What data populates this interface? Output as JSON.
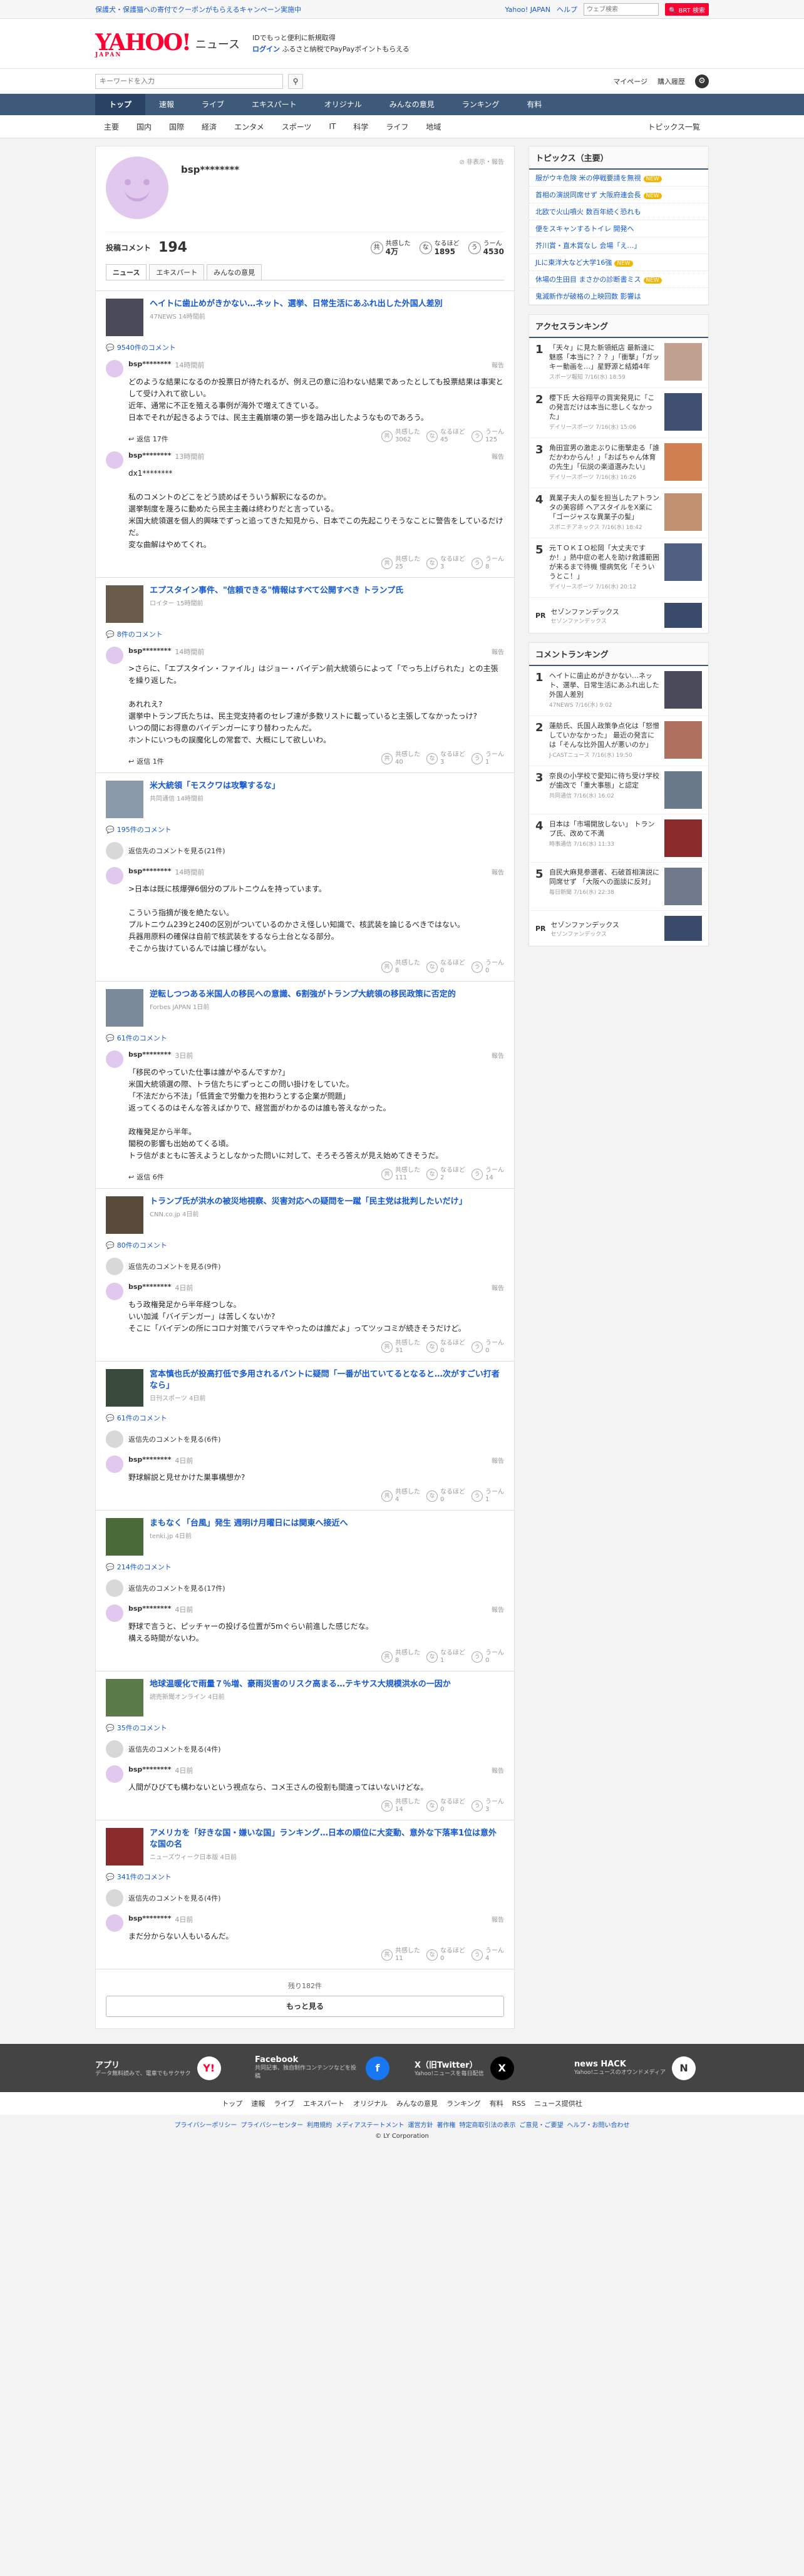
{
  "topbar": {
    "promo": "保護犬・保護猫への寄付でクーポンがもらえるキャンペーン実施中",
    "yahoo": "Yahoo! JAPAN",
    "help": "ヘルプ",
    "search_placeholder": "ウェブ検索",
    "search_btn": "🔍 BRT 検索"
  },
  "header": {
    "logo": "YAHOO!",
    "logo_sub": "JAPAN",
    "service": "ニュース",
    "line1": "IDでもっと便利に新規取得",
    "login": "ログイン",
    "line2": "ふるさと納税でPayPayポイントもらえる"
  },
  "searchrow": {
    "placeholder": "キーワードを入力",
    "mypage": "マイページ",
    "history": "購入履歴"
  },
  "nav": [
    "トップ",
    "速報",
    "ライブ",
    "エキスパート",
    "オリジナル",
    "みんなの意見",
    "ランキング",
    "有料"
  ],
  "subnav": [
    "主要",
    "国内",
    "国際",
    "経済",
    "エンタメ",
    "スポーツ",
    "IT",
    "科学",
    "ライフ",
    "地域"
  ],
  "subnav_right": "トピックス一覧",
  "profile": {
    "name": "bsp********",
    "report": "非表示・報告",
    "label": "投稿コメント",
    "count": "194",
    "reacts": [
      {
        "icon": "共",
        "label": "共感した",
        "value": "4万"
      },
      {
        "icon": "な",
        "label": "なるほど",
        "value": "1895"
      },
      {
        "icon": "う",
        "label": "うーん",
        "value": "4530"
      }
    ],
    "tabs": [
      "ニュース",
      "エキスパート",
      "みんなの意見"
    ]
  },
  "articles": [
    {
      "title": "ヘイトに歯止めがきかない…ネット、選挙、日常生活にあふれ出した外国人差別",
      "src": "47NEWS 14時間前",
      "cmt": "9540件のコメント",
      "thumb": "#4a4a5a",
      "viewall": null,
      "comments": [
        {
          "user": "bsp********",
          "time": "14時間前",
          "text": "どのような結果になるのか投票日が待たれるが、例え己の意に沿わない結果であったとしても投票結果は事実として受け入れて欲しい。\n近年、通常に不正を殖える事例が海外で増えてきている。\n日本でそれが起きるようでは、民主主義崩壊の第一歩を踏み出したようなものであろう。",
          "reply": "返信 17件",
          "votes": [
            "3062",
            "45",
            "125"
          ]
        },
        {
          "user": "bsp********",
          "time": "13時間前",
          "text": "dx1********\n\n私のコメントのどこをどう読めばそういう解釈になるのか。\n選挙制度を蔑ろに動めたら民主主義は終わりだと言っている。\n米国大統領選を個人的興味でずっと追ってきた知見から、日本でこの先起こりそうなことに警告をしているだけだ。\n変な曲解はやめてくれ。",
          "reply": "",
          "votes": [
            "25",
            "3",
            "8"
          ]
        }
      ]
    },
    {
      "title": "エプスタイン事件、\"信頼できる\"情報はすべて公開すべき トランプ氏",
      "src": "ロイター 15時間前",
      "cmt": "8件のコメント",
      "thumb": "#6a5a4a",
      "viewall": null,
      "comments": [
        {
          "user": "bsp********",
          "time": "14時間前",
          "text": ">さらに、「エプスタイン・ファイル」はジョー・バイデン前大統領らによって「でっち上げられた」との主張を繰り返した。\n\nあれれえ?\n選挙中トランプ氏たちは、民主党支持者のセレブ達が多数リストに載っていると主張してなかったっけ?\nいつの間にお得意のバイデンガーにすり替わったんだ。\nホントにいつもの誤魔化しの常套で、大概にして欲しいわ。",
          "reply": "返信 1件",
          "votes": [
            "40",
            "3",
            "1"
          ]
        }
      ]
    },
    {
      "title": "米大統領「モスクワは攻撃するな」",
      "src": "共同通信 14時間前",
      "cmt": "195件のコメント",
      "thumb": "#8a9aaa",
      "viewall": "返信先のコメントを見る(21件)",
      "comments": [
        {
          "user": "bsp********",
          "time": "14時間前",
          "text": ">日本は既に核爆弾6個分のプルトニウムを持っています。\n\nこういう指摘が後を絶たない。\nプルトニウム239と240の区別がついているのかさえ怪しい知識で、核武装を論じるべきではない。\n兵器用原料の確保は自前で核武装をするなら土台となる部分。\nそこから抜けているんでは論じ様がない。",
          "reply": "",
          "votes": [
            "8",
            "0",
            "0"
          ]
        }
      ]
    },
    {
      "title": "逆転しつつある米国人の移民への意識、6割強がトランプ大統領の移民政策に否定的",
      "src": "Forbes JAPAN 1日前",
      "cmt": "61件のコメント",
      "thumb": "#7a8a9a",
      "viewall": null,
      "comments": [
        {
          "user": "bsp********",
          "time": "3日前",
          "text": "「移民のやっていた仕事は誰がやるんですか?」\n米国大統領選の際、トラ信たちにずっとこの問い掛けをしていた。\n「不法だから不法」「低賃金で労働力を抱わうとする企業が問題」\n返ってくるのはそんな答えばかりで、経営面がわかるのは誰も答えなかった。\n\n政権発足から半年。\n閣税の影響も出始めてくる頃。\nトラ信がまともに答えようとしなかった問いに対して、そろそろ答えが見え始めてきそうだ。",
          "reply": "返信 6件",
          "votes": [
            "111",
            "2",
            "14"
          ]
        }
      ]
    },
    {
      "title": "トランプ氏が洪水の被災地視察、災害対応への疑問を一蹴「民主党は批判したいだけ」",
      "src": "CNN.co.jp 4日前",
      "cmt": "80件のコメント",
      "thumb": "#5a4a3a",
      "viewall": "返信先のコメントを見る(9件)",
      "comments": [
        {
          "user": "bsp********",
          "time": "4日前",
          "text": "もう政権発足から半年経つしな。\nいい加減「バイデンガー」は苦しくないか?\nそこに「バイデンの所にコロナ対策でバラマキやったのは誰だよ」ってツッコミが続きそうだけど。",
          "reply": "",
          "votes": [
            "31",
            "0",
            "0"
          ]
        }
      ]
    },
    {
      "title": "宮本慎也氏が投高打低で多用されるバントに疑問「一番が出ていてるとなると…次がすごい打者なら」",
      "src": "日刊スポーツ 4日前",
      "cmt": "61件のコメント",
      "thumb": "#3a4a3a",
      "viewall": "返信先のコメントを見る(6件)",
      "comments": [
        {
          "user": "bsp********",
          "time": "4日前",
          "text": "野球解説と見せかけた巣事構想か?",
          "reply": "",
          "votes": [
            "4",
            "0",
            "1"
          ]
        }
      ]
    },
    {
      "title": "まもなく「台風」発生 週明け月曜日には関東へ接近へ",
      "src": "tenki.jp 4日前",
      "cmt": "214件のコメント",
      "thumb": "#4a6a3a",
      "viewall": "返信先のコメントを見る(17件)",
      "comments": [
        {
          "user": "bsp********",
          "time": "4日前",
          "text": "野球で言うと、ピッチャーの投げる位置が5mぐらい前進した感じだな。\n構える時間がないわ。",
          "reply": "",
          "votes": [
            "8",
            "1",
            "0"
          ]
        }
      ]
    },
    {
      "title": "地球温暖化で雨量７％増、豪雨災害のリスク高まる…テキサス大規模洪水の一因か",
      "src": "読売新聞オンライン 4日前",
      "cmt": "35件のコメント",
      "thumb": "#5a7a4a",
      "viewall": "返信先のコメントを見る(4件)",
      "comments": [
        {
          "user": "bsp********",
          "time": "4日前",
          "text": "人間がひびても構わないという視点なら、コメ王さんの役割も間違ってはいないけどな。",
          "reply": "",
          "votes": [
            "14",
            "0",
            "3"
          ]
        }
      ]
    },
    {
      "title": "アメリカを「好きな国・嫌いな国」ランキング…日本の順位に大変動、意外な下落率1位は意外な国の名",
      "src": "ニューズウィーク日本版 4日前",
      "cmt": "341件のコメント",
      "thumb": "#8a2a2a",
      "viewall": "返信先のコメントを見る(4件)",
      "comments": [
        {
          "user": "bsp********",
          "time": "4日前",
          "text": "まだ分からない人もいるんだ。",
          "reply": "",
          "votes": [
            "11",
            "0",
            "4"
          ]
        }
      ]
    }
  ],
  "more": {
    "remaining": "残り182件",
    "button": "もっと見る"
  },
  "vote_labels": [
    "共感した",
    "なるほど",
    "うーん"
  ],
  "report_label": "報告",
  "topics": {
    "title": "トピックス（主要）",
    "items": [
      {
        "t": "服がウキ危険 米の停戦要請を無視",
        "b": "NEW"
      },
      {
        "t": "首相の演説同席せず 大阪府連会長",
        "b": "NEW"
      },
      {
        "t": "北欧で火山噴火 数百年続く恐れも",
        "b": ""
      },
      {
        "t": "便をスキャンするトイレ 開発へ",
        "b": ""
      },
      {
        "t": "芥川賞・直木賞なし 会場「え…」",
        "b": ""
      },
      {
        "t": "JLに東洋大など大学16強",
        "b": "NEW"
      },
      {
        "t": "休場の生田目 まさかの診断書ミス",
        "b": "NEW"
      },
      {
        "t": "鬼滅新作が破格の上映回数 影響は",
        "b": ""
      }
    ]
  },
  "access": {
    "title": "アクセスランキング",
    "items": [
      {
        "t": "「天々」に見た新領紙店 最新達に魅惑「本当に？？？」「衝撃」「ガッキー動画を…」星野源と結婚4年",
        "m": "スポーツ報知 7/16(水) 18:59",
        "c": "#c0a090"
      },
      {
        "t": "櫻下氏 大谷翔平の買実発見に「この発言だけは本当に悲しくなかった」",
        "m": "デイリースポーツ 7/16(水) 15:06",
        "c": "#405070"
      },
      {
        "t": "角田宣男の激走ぶりに衝撃走る「誰だかわからん！」「おばちゃん体育の先生」「伝説の楽道選みたい」",
        "m": "デイリースポーツ 7/16(水) 16:26",
        "c": "#d08050"
      },
      {
        "t": "異業子夫人の髪を担当したアトランタの美容師 ヘアスタイルをX楽に「ゴージャスな異業子の髪」",
        "m": "スポニチアネックス 7/16(水) 18:42",
        "c": "#c09070"
      },
      {
        "t": "元ＴＯＫＩＯ松岡「大丈夫ですか！」熱中症の老人を助け救護範囲が来るまで待機 慢病気化「そういうとこ！」",
        "m": "デイリースポーツ 7/16(水) 20:12",
        "c": "#506080"
      }
    ],
    "pr_tag": "PR",
    "pr": "セゾンファンデックス",
    "pr_sub": "セゾンファンデックス"
  },
  "commentrank": {
    "title": "コメントランキング",
    "items": [
      {
        "t": "ヘイトに歯止めがきかない…ネット、選挙、日常生活にあふれ出した外国人差別",
        "m": "47NEWS 7/16(水) 9:02",
        "c": "#4a4a5a"
      },
      {
        "t": "蓮舫氏、氏国人政策争点化は「怒憎していかなかった」 最近の発言には「そんな比外国人が悪いのか」",
        "m": "J-CASTニュース 7/16(水) 19:50",
        "c": "#b07060"
      },
      {
        "t": "奈良の小学校で愛知に待ち受け学校が歯改で「重大事態」と認定",
        "m": "共同通信 7/16(水) 16:02",
        "c": "#6a7a8a"
      },
      {
        "t": "日本は「市場開放しない」 トランプ氏、改めて不満",
        "m": "時事通信 7/16(水) 11:33",
        "c": "#8a2a2a"
      },
      {
        "t": "自民大麻見参選者、石破首相演説に同席せず 「大阪への面談に反対」",
        "m": "毎日新聞 7/16(水) 22:38",
        "c": "#707a8a"
      }
    ],
    "pr_tag": "PR",
    "pr": "セゾンファンデックス",
    "pr_sub": "セゾンファンデックス"
  },
  "footer": {
    "blocks": [
      {
        "t": "アプリ",
        "d": "データ無料読みで、電車でもサクサク",
        "i": "Y!",
        "c": "#fff",
        "fc": "#ff0033"
      },
      {
        "t": "Facebook",
        "d": "共同記事、独自制作コンテンツなどを投稿",
        "i": "f",
        "c": "#1877f2",
        "fc": "#fff"
      },
      {
        "t": "X（旧Twitter）",
        "d": "Yahoo!ニュースを毎日配信",
        "i": "X",
        "c": "#000",
        "fc": "#fff"
      },
      {
        "t": "news HACK",
        "d": "Yahoo!ニュースのオウンドメディア",
        "i": "N",
        "c": "#fff",
        "fc": "#333"
      }
    ],
    "nav": [
      "トップ",
      "速報",
      "ライブ",
      "エキスパート",
      "オリジナル",
      "みんなの意見",
      "ランキング",
      "有料",
      "RSS",
      "ニュース提供社"
    ],
    "legal": [
      "プライバシーポリシー",
      "プライバシーセンター",
      "利用規約",
      "メディアステートメント",
      "運営方針",
      "著作権",
      "特定商取引法の表示",
      "ご意見・ご要望",
      "ヘルプ・お問い合わせ"
    ],
    "copy": "© LY Corporation"
  }
}
